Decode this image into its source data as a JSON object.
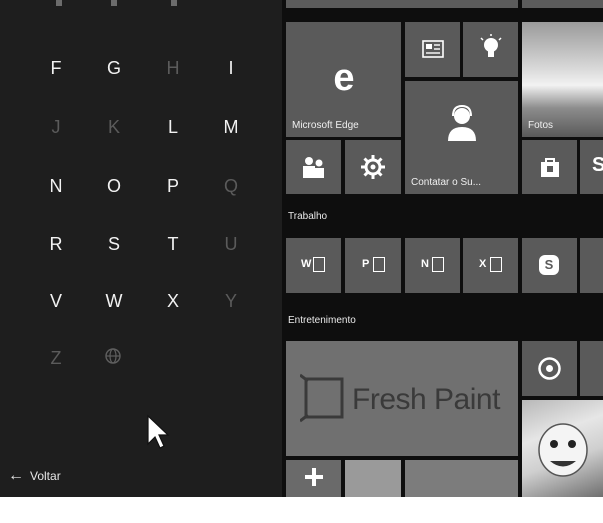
{
  "alphabet": {
    "rows": [
      [
        {
          "ch": "F",
          "active": true
        },
        {
          "ch": "G",
          "active": true
        },
        {
          "ch": "H",
          "active": false
        },
        {
          "ch": "I",
          "active": true
        }
      ],
      [
        {
          "ch": "J",
          "active": false
        },
        {
          "ch": "K",
          "active": false
        },
        {
          "ch": "L",
          "active": true
        },
        {
          "ch": "M",
          "active": true
        }
      ],
      [
        {
          "ch": "N",
          "active": true
        },
        {
          "ch": "O",
          "active": true
        },
        {
          "ch": "P",
          "active": true
        },
        {
          "ch": "Q",
          "active": false
        }
      ],
      [
        {
          "ch": "R",
          "active": true
        },
        {
          "ch": "S",
          "active": true
        },
        {
          "ch": "T",
          "active": true
        },
        {
          "ch": "U",
          "active": false
        }
      ],
      [
        {
          "ch": "V",
          "active": true
        },
        {
          "ch": "W",
          "active": true
        },
        {
          "ch": "X",
          "active": true
        },
        {
          "ch": "Y",
          "active": false
        }
      ],
      [
        {
          "ch": "Z",
          "active": false
        }
      ]
    ],
    "globe_icon": "globe-icon"
  },
  "back": {
    "label": "Voltar",
    "icon": "back-arrow-icon"
  },
  "tiles": {
    "edge_label": "Microsoft Edge",
    "fotos_label": "Fotos",
    "contact_label": "Contatar o Su...",
    "freshpaint_label": "Fresh Paint"
  },
  "groups": {
    "trabalho": "Trabalho",
    "entretenimento": "Entretenimento"
  },
  "office_apps": [
    "W",
    "P",
    "N",
    "X",
    "S"
  ]
}
